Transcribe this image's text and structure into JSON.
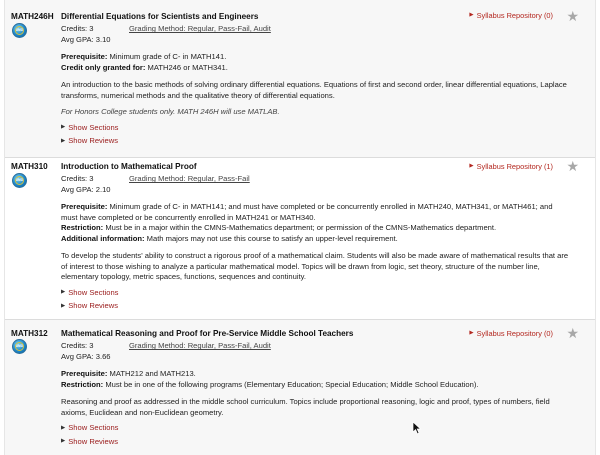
{
  "courses": [
    {
      "code": "MATH246H",
      "title": "Differential Equations for Scientists and Engineers",
      "credits": "Credits: 3",
      "grading_label": "Grading Method",
      "grading_value": ": Regular, Pass-Fail, Audit",
      "gpa": "Avg GPA: 3.10",
      "syllabus": "Syllabus Repository (0)",
      "info": [
        {
          "label": "Prerequisite:",
          "text": " Minimum grade of C- in MATH141."
        },
        {
          "label": "Credit only granted for:",
          "text": " MATH246 or MATH341."
        }
      ],
      "description": "An introduction to the basic methods of solving ordinary differential equations. Equations of first and second order, linear differential equations, Laplace transforms, numerical methods and the qualitative theory of differential equations.",
      "note": "For Honors College students only. MATH 246H will use MATLAB.",
      "show_sections": "Show Sections",
      "show_reviews": "Show Reviews"
    },
    {
      "code": "MATH310",
      "title": "Introduction to Mathematical Proof",
      "credits": "Credits: 3",
      "grading_label": "Grading Method",
      "grading_value": ": Regular, Pass-Fail",
      "gpa": "Avg GPA: 2.10",
      "syllabus": "Syllabus Repository (1)",
      "info": [
        {
          "label": "Prerequisite:",
          "text": " Minimum grade of C- in MATH141; and must have completed or be concurrently enrolled in MATH240, MATH341, or MATH461; and must have completed or be concurrently enrolled in MATH241 or MATH340."
        },
        {
          "label": "Restriction:",
          "text": " Must be in a major within the CMNS-Mathematics department; or permission of the CMNS-Mathematics department."
        },
        {
          "label": "Additional information:",
          "text": " Math majors may not use this course to satisfy an upper-level requirement."
        }
      ],
      "description": "To develop the students' ability to construct a rigorous proof of a mathematical claim. Students will also be made aware of mathematical results that are of interest to those wishing to analyze a particular mathematical model. Topics will be drawn from logic, set theory, structure of the number line, elementary topology, metric spaces, functions, sequences and continuity.",
      "show_sections": "Show Sections",
      "show_reviews": "Show Reviews"
    },
    {
      "code": "MATH312",
      "title": "Mathematical Reasoning and Proof for Pre-Service Middle School Teachers",
      "credits": "Credits: 3",
      "grading_label": "Grading Method",
      "grading_value": ": Regular, Pass-Fail, Audit",
      "gpa": "Avg GPA: 3.66",
      "syllabus": "Syllabus Repository (0)",
      "info": [
        {
          "label": "Prerequisite:",
          "text": " MATH212 and MATH213."
        },
        {
          "label": "Restriction:",
          "text": " Must be in one of the following programs (Elementary Education; Special Education; Middle School Education)."
        }
      ],
      "description": "Reasoning and proof as addressed in the middle school curriculum. Topics include proportional reasoning, logic and proof, types of numbers, field axioms, Euclidean and non-Euclidean geometry.",
      "show_sections": "Show Sections",
      "show_reviews": "Show Reviews"
    }
  ],
  "icons": {
    "badge": "gened-badge-icon",
    "arrow": "triangle-right-icon",
    "star": "star-icon",
    "cursor": "mouse-pointer-icon"
  },
  "colors": {
    "link_red": "#9a1b1b",
    "syllabus_red": "#b3271f",
    "star_gray": "#a8a8a8",
    "shaded_row": "#f7f7f7"
  }
}
